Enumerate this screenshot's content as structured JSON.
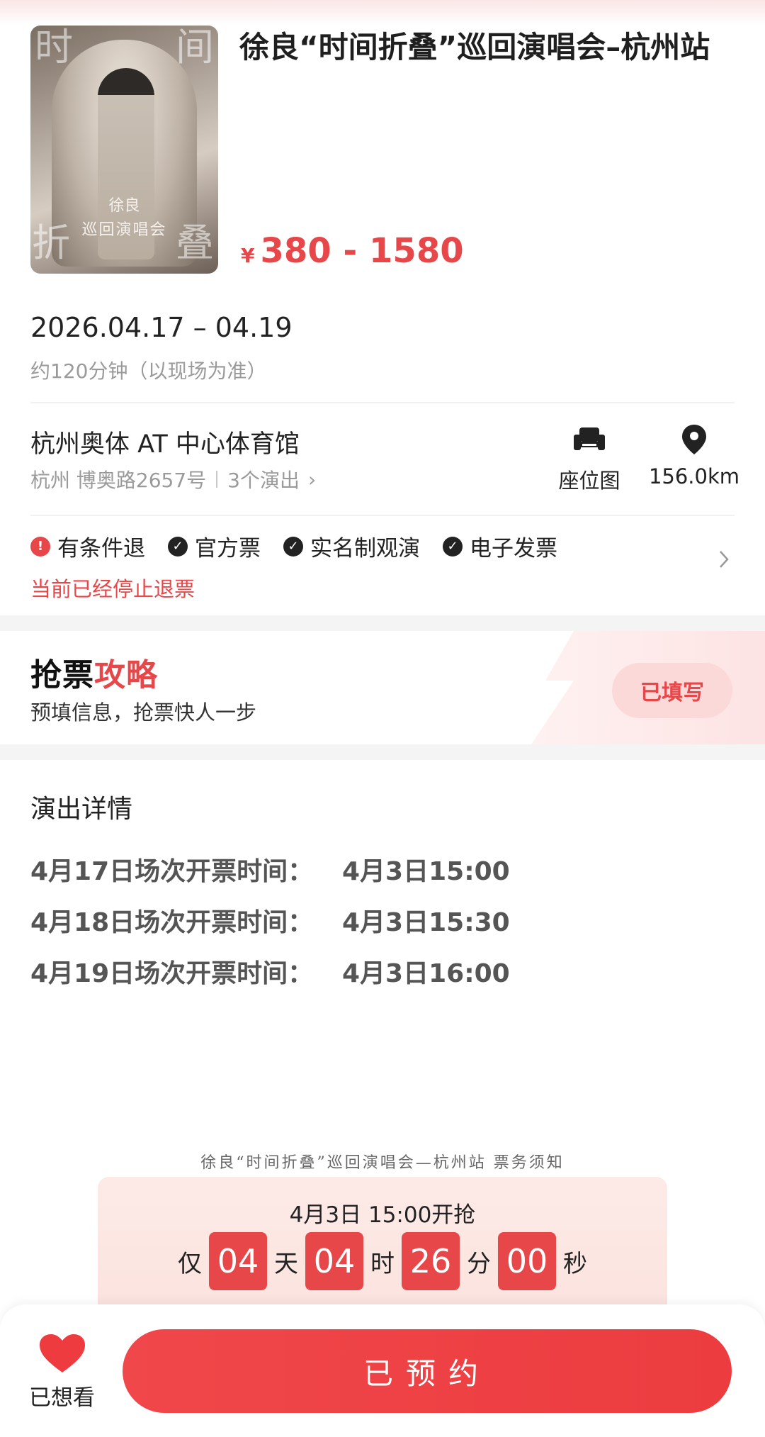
{
  "event": {
    "title": "徐良“时间折叠”巡回演唱会–杭州站",
    "price_symbol": "¥",
    "price_range": "380 - 1580",
    "poster": {
      "name_text": "徐良",
      "subtitle_text": "巡回演唱会",
      "corner_left_top": "时",
      "corner_right_top": "间",
      "corner_left_bottom": "折",
      "corner_right_bottom": "叠"
    },
    "date_range": "2026.04.17 – 04.19",
    "duration": "约120分钟（以现场为准）"
  },
  "venue": {
    "name": "杭州奥体 AT 中心体育馆",
    "address": "杭州 博奥路2657号",
    "shows": "3个演出",
    "seat_map_label": "座位图",
    "distance": "156.0km"
  },
  "tags": [
    {
      "label": "有条件退",
      "icon": "exclamation-icon",
      "color": "#e8474a"
    },
    {
      "label": "官方票",
      "icon": "check-icon"
    },
    {
      "label": "实名制观演",
      "icon": "check-icon"
    },
    {
      "label": "电子发票",
      "icon": "check-icon"
    }
  ],
  "refund_notice": "当前已经停止退票",
  "strategy": {
    "title_a": "抢票",
    "title_b": "攻略",
    "subtitle": "预填信息，抢票快人一步",
    "button": "已填写"
  },
  "details": {
    "heading": "演出详情",
    "rows": [
      {
        "label": "4月17日场次开票时间：",
        "time": "4月3日15:00"
      },
      {
        "label": "4月18日场次开票时间：",
        "time": "4月3日15:30"
      },
      {
        "label": "4月19日场次开票时间：",
        "time": "4月3日16:00"
      }
    ]
  },
  "notice_title": "徐良“时间折叠”巡回演唱会—杭州站  票务须知",
  "countdown": {
    "headline": "4月3日  15:00开抢",
    "prefix": "仅",
    "days": "04",
    "days_unit": "天",
    "hours": "04",
    "hours_unit": "时",
    "minutes": "26",
    "minutes_unit": "分",
    "seconds": "00",
    "seconds_unit": "秒"
  },
  "bottom_bar": {
    "wish_label": "已想看",
    "reserve_label": "已预约"
  },
  "colors": {
    "accent": "#e8474a",
    "muted": "#9a9a9a"
  }
}
